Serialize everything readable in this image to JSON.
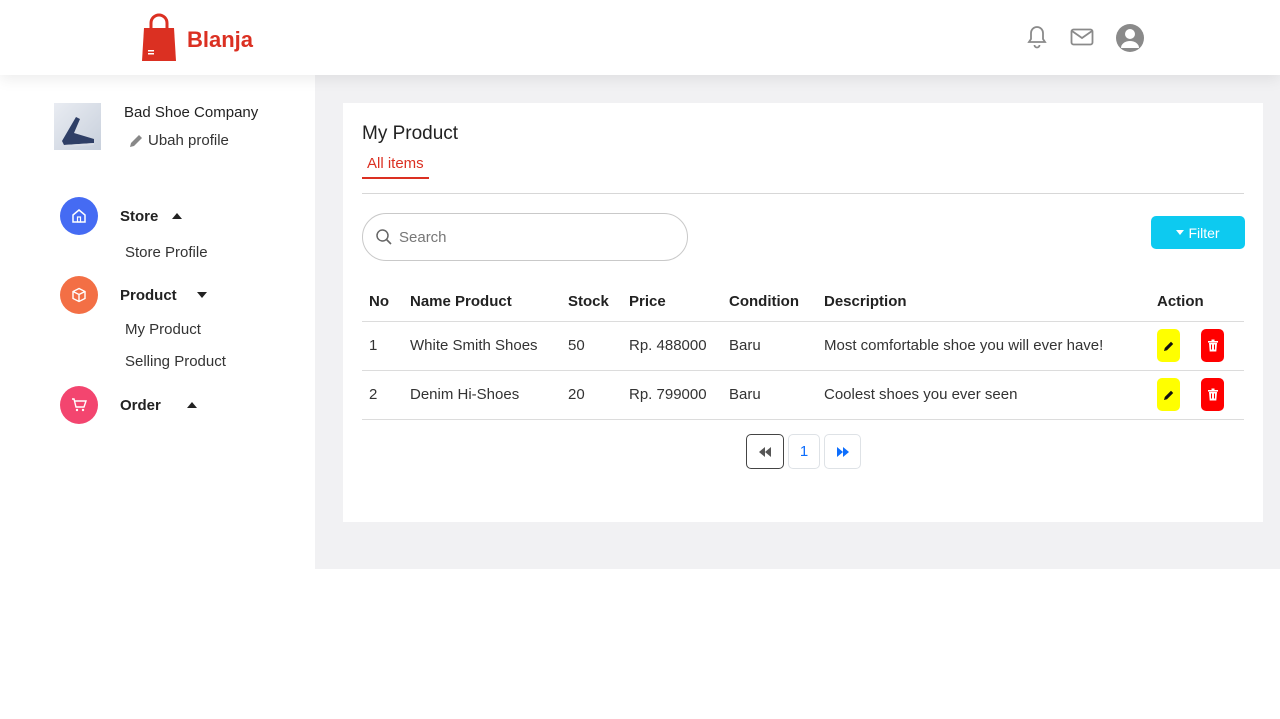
{
  "header": {
    "brand": "Blanja",
    "icons": [
      "bell-icon",
      "mail-icon",
      "user-avatar-icon"
    ]
  },
  "sidebar": {
    "shop_name": "Bad Shoe Company",
    "edit_profile": "Ubah profile",
    "groups": [
      {
        "label": "Store",
        "icon": "home-icon",
        "color": "#456bf3",
        "expanded": true,
        "items": [
          "Store Profile"
        ]
      },
      {
        "label": "Product",
        "icon": "package-icon",
        "color": "#f36f45",
        "expanded": true,
        "items": [
          "My Product",
          "Selling Product"
        ]
      },
      {
        "label": "Order",
        "icon": "cart-icon",
        "color": "#f3456f",
        "expanded": false,
        "items": []
      }
    ]
  },
  "main": {
    "title": "My Product",
    "tab": "All items",
    "search_placeholder": "Search",
    "filter_label": "Filter",
    "columns": [
      "No",
      "Name Product",
      "Stock",
      "Price",
      "Condition",
      "Description",
      "Action"
    ],
    "rows": [
      {
        "no": "1",
        "name": "White Smith Shoes",
        "stock": "50",
        "price": "Rp. 488000",
        "condition": "Baru",
        "description": "Most comfortable shoe you will ever have!"
      },
      {
        "no": "2",
        "name": "Denim Hi-Shoes",
        "stock": "20",
        "price": "Rp. 799000",
        "condition": "Baru",
        "description": "Coolest shoes you ever seen"
      }
    ],
    "pagination": {
      "current_page": "1"
    }
  },
  "colors": {
    "brand": "#db3022",
    "filter": "#0dcaf0",
    "edit": "#ffff00",
    "delete": "#ff0000",
    "link": "#0d6efd"
  }
}
